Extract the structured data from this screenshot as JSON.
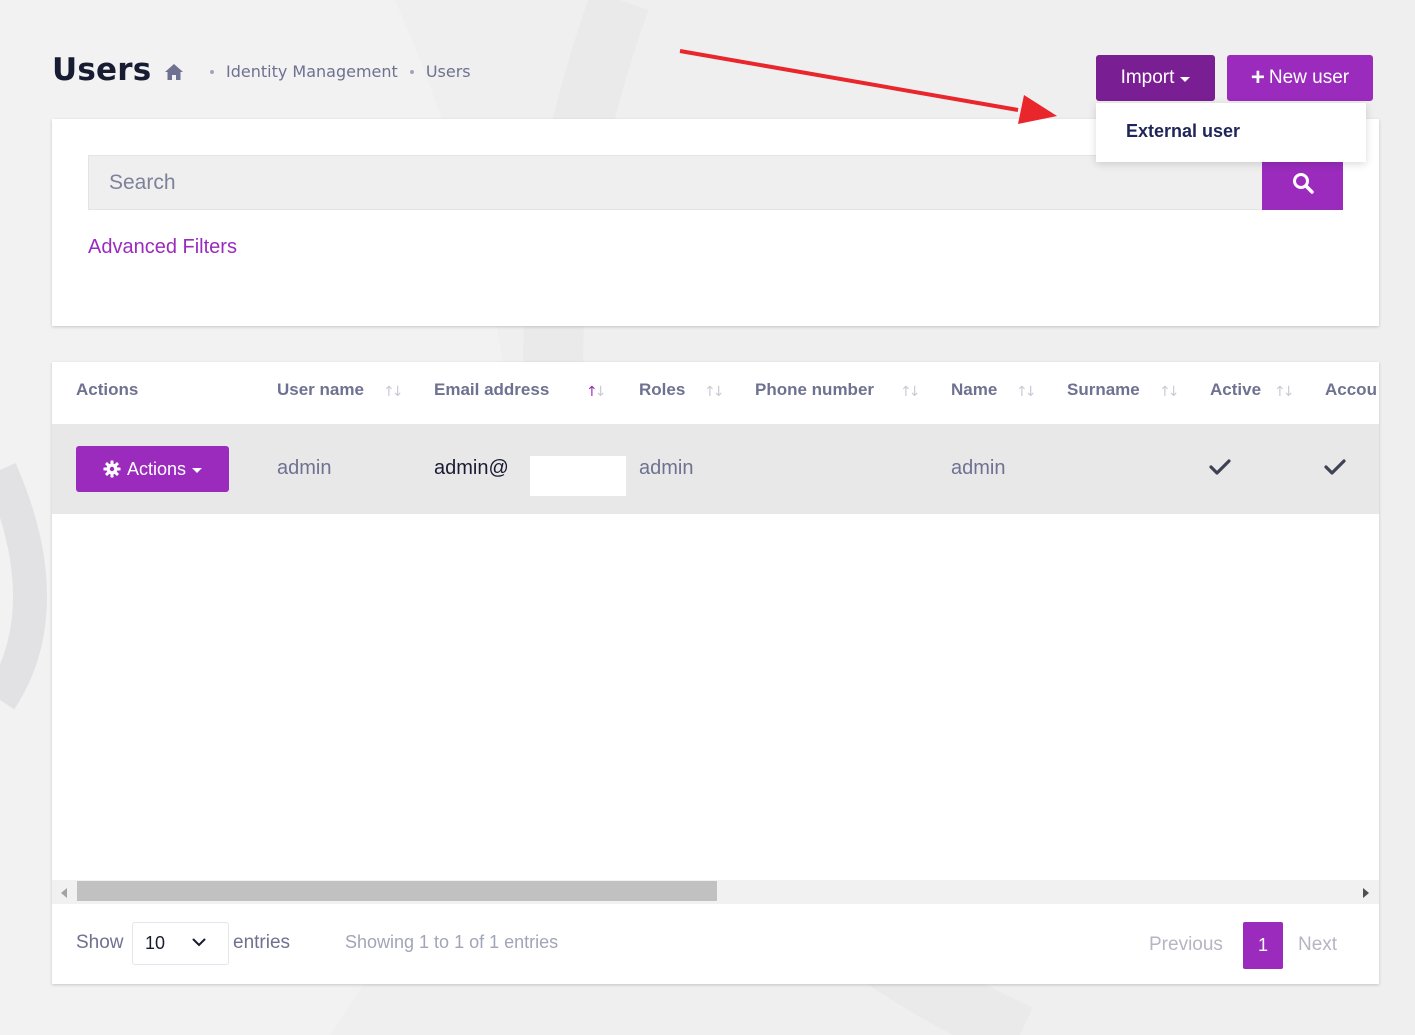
{
  "header": {
    "title": "Users",
    "breadcrumb": [
      "Identity Management",
      "Users"
    ]
  },
  "toolbar": {
    "import_label": "Import",
    "new_user_label": "New user"
  },
  "import_menu": {
    "items": [
      "External user"
    ]
  },
  "search": {
    "placeholder": "Search",
    "value": "",
    "advanced_filters_label": "Advanced Filters"
  },
  "table": {
    "columns": [
      "Actions",
      "User name",
      "Email address",
      "Roles",
      "Phone number",
      "Name",
      "Surname",
      "Active",
      "Accou"
    ],
    "sorted_column": "Email address",
    "rows": [
      {
        "actions_label": "Actions",
        "user_name": "admin",
        "email_address": "admin@",
        "roles": "admin",
        "phone_number": "",
        "name": "admin",
        "surname": "",
        "active": true,
        "account": true
      }
    ]
  },
  "footer": {
    "show_label": "Show",
    "page_length": "10",
    "entries_label": "entries",
    "info": "Showing 1 to 1 of 1 entries",
    "previous_label": "Previous",
    "current_page": "1",
    "next_label": "Next"
  },
  "colors": {
    "primary": "#9b2bbd",
    "primary_dark": "#7a1e93",
    "annotation_arrow": "#e8262b"
  },
  "icons": [
    "home-icon",
    "search-icon",
    "gear-icon",
    "check-icon",
    "plus-icon",
    "chevron-down-icon",
    "caret-down-icon",
    "sort-icon"
  ]
}
